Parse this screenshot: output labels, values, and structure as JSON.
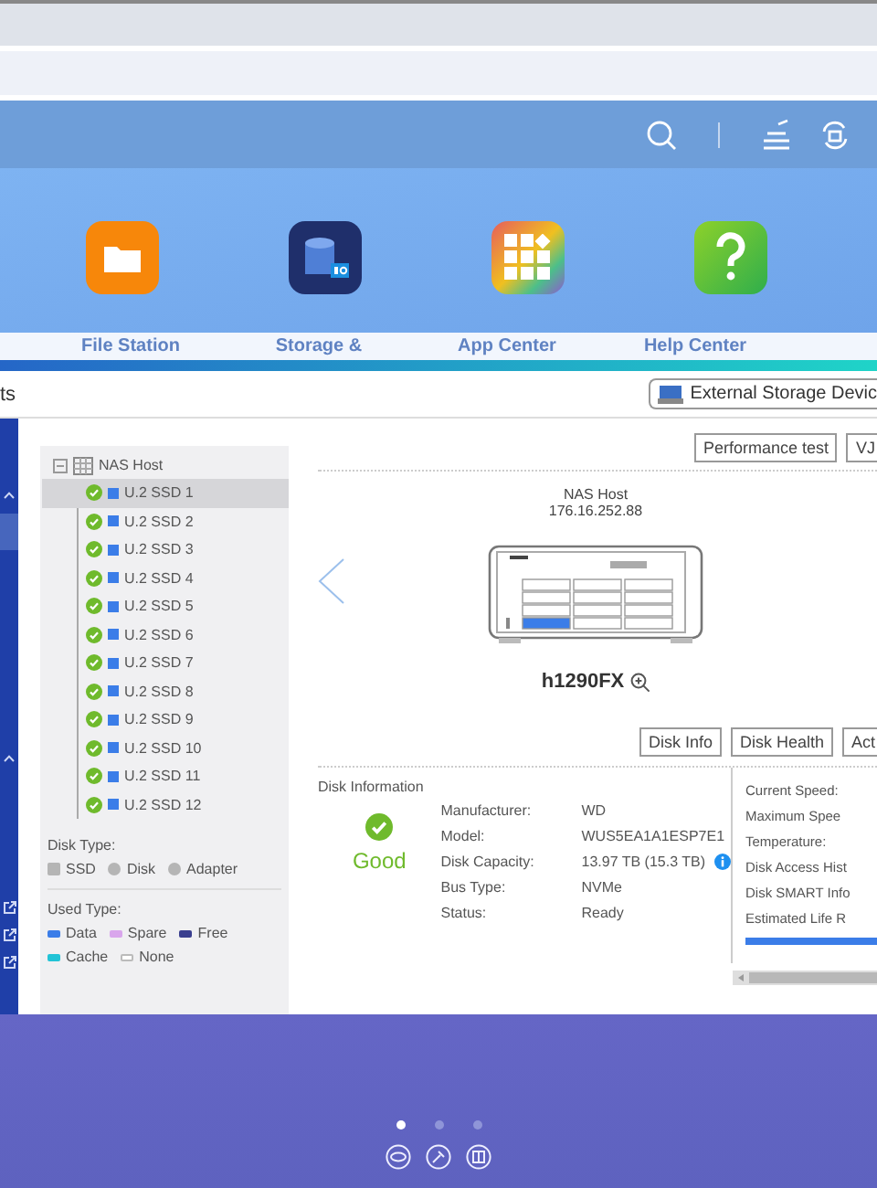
{
  "desktop_apps": [
    {
      "label": "File Station",
      "kind": "folder"
    },
    {
      "label": "Storage &",
      "kind": "storage"
    },
    {
      "label": "App Center",
      "kind": "apps"
    },
    {
      "label": "Help Center",
      "kind": "help"
    }
  ],
  "window": {
    "title": "ts",
    "toolbar_button": "External Storage Devic"
  },
  "tree": {
    "label": "NAS Host",
    "expanded": true,
    "children": [
      {
        "label": "U.2 SSD 1",
        "selected": true
      },
      {
        "label": "U.2 SSD 2",
        "selected": false
      },
      {
        "label": "U.2 SSD 3",
        "selected": false
      },
      {
        "label": "U.2 SSD 4",
        "selected": false
      },
      {
        "label": "U.2 SSD 5",
        "selected": false
      },
      {
        "label": "U.2 SSD 6",
        "selected": false
      },
      {
        "label": "U.2 SSD 7",
        "selected": false
      },
      {
        "label": "U.2 SSD 8",
        "selected": false
      },
      {
        "label": "U.2 SSD 9",
        "selected": false
      },
      {
        "label": "U.2 SSD 10",
        "selected": false
      },
      {
        "label": "U.2 SSD 11",
        "selected": false
      },
      {
        "label": "U.2 SSD 12",
        "selected": false
      }
    ]
  },
  "disk_type": {
    "title": "Disk Type:",
    "items": [
      {
        "label": "SSD",
        "kind": "square"
      },
      {
        "label": "Disk",
        "kind": "circle"
      },
      {
        "label": "Adapter",
        "kind": "circle"
      }
    ]
  },
  "used_type": {
    "title": "Used Type:",
    "items": [
      {
        "label": "Data",
        "color": "#3b7de8"
      },
      {
        "label": "Spare",
        "color": "#d9a6ec"
      },
      {
        "label": "Free",
        "color": "#3a3f8f"
      },
      {
        "label": "Cache",
        "color": "#22c3d6"
      },
      {
        "label": "None",
        "color": "#ffffff"
      }
    ]
  },
  "actions": [
    "Performance test",
    "VJ"
  ],
  "device": {
    "name": "NAS Host",
    "ip": "176.16.252.88",
    "model": "h1290FX"
  },
  "disk_buttons": [
    "Disk Info",
    "Disk Health",
    "Act"
  ],
  "disk_information": {
    "title": "Disk Information",
    "status": "Good",
    "fields": [
      {
        "label": "Manufacturer:",
        "value": "WD"
      },
      {
        "label": "Model:",
        "value": "WUS5EA1A1ESP7E1"
      },
      {
        "label": "Disk Capacity:",
        "value": "13.97 TB (15.3 TB)"
      },
      {
        "label": "Bus Type:",
        "value": "NVMe"
      },
      {
        "label": "Status:",
        "value": "Ready"
      }
    ],
    "right_fields": [
      "Current Speed:",
      "Maximum Spee",
      "Temperature:",
      "Disk Access Hist",
      "Disk SMART Info",
      "Estimated Life R"
    ],
    "life": {
      "level": 1
    }
  },
  "pager": [
    {
      "selected": true
    },
    {
      "selected": false
    },
    {
      "selected": false
    }
  ]
}
